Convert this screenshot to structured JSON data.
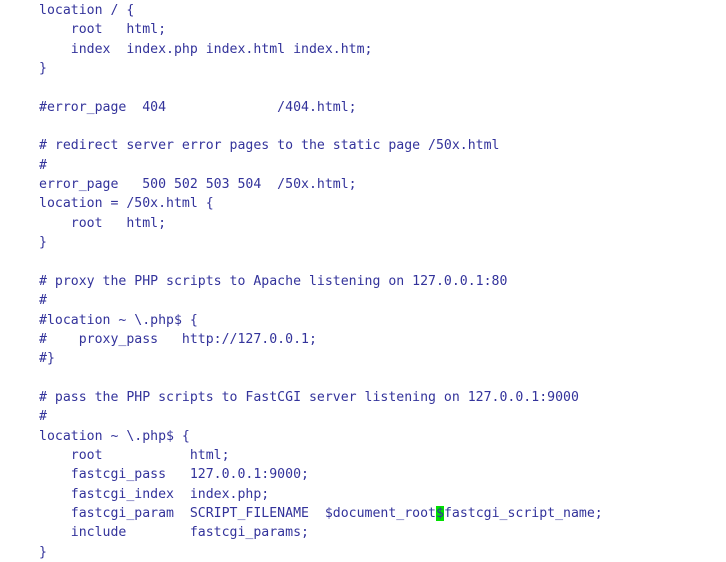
{
  "editor": {
    "name": "nginx-config-text-view",
    "background_color": "#ffffff",
    "text_color": "#33339b",
    "cursor_color": "#00e000",
    "font": "monospace",
    "cursor": {
      "line_index": 26,
      "character": "$",
      "prefix": "        fastcgi_param  SCRIPT_FILENAME  $document_root",
      "suffix": "fastcgi_script_name;"
    },
    "lines": [
      "    location / {",
      "        root   html;",
      "        index  index.php index.html index.htm;",
      "    }",
      "",
      "    #error_page  404              /404.html;",
      "",
      "    # redirect server error pages to the static page /50x.html",
      "    #",
      "    error_page   500 502 503 504  /50x.html;",
      "    location = /50x.html {",
      "        root   html;",
      "    }",
      "",
      "    # proxy the PHP scripts to Apache listening on 127.0.0.1:80",
      "    #",
      "    #location ~ \\.php$ {",
      "    #    proxy_pass   http://127.0.0.1;",
      "    #}",
      "",
      "    # pass the PHP scripts to FastCGI server listening on 127.0.0.1:9000",
      "    #",
      "    location ~ \\.php$ {",
      "        root           html;",
      "        fastcgi_pass   127.0.0.1:9000;",
      "        fastcgi_index  index.php;",
      "        fastcgi_param  SCRIPT_FILENAME  $document_root$fastcgi_script_name;",
      "        include        fastcgi_params;",
      "    }"
    ]
  }
}
